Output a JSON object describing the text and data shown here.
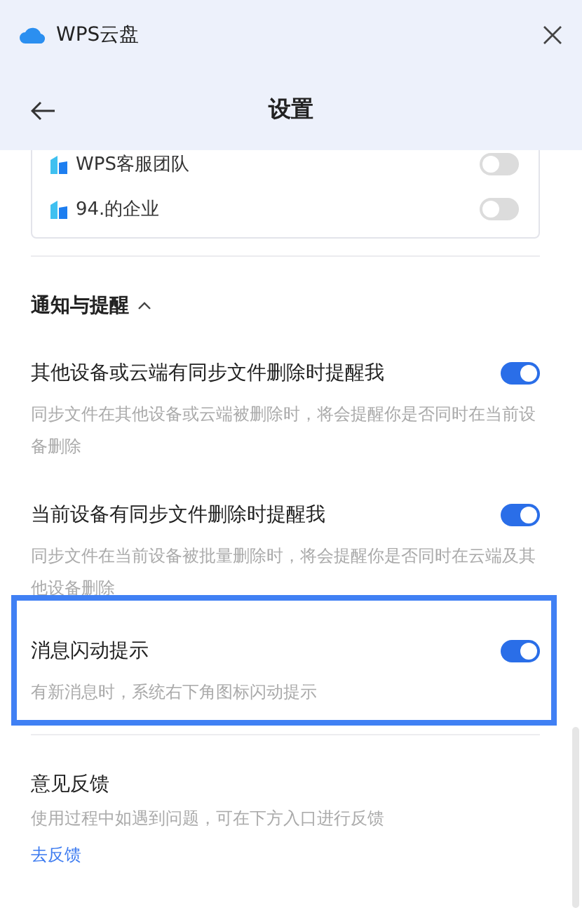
{
  "window": {
    "title": "WPS云盘"
  },
  "header": {
    "title": "设置"
  },
  "teams": [
    {
      "name": "WPS客服团队",
      "on": false
    },
    {
      "name": "94.的企业",
      "on": false
    }
  ],
  "section": {
    "title": "通知与提醒",
    "expanded": true
  },
  "settings": [
    {
      "title": "其他设备或云端有同步文件删除时提醒我",
      "description": "同步文件在其他设备或云端被删除时，将会提醒你是否同时在当前设备删除",
      "on": true,
      "highlighted": false
    },
    {
      "title": "当前设备有同步文件删除时提醒我",
      "description": "同步文件在当前设备被批量删除时，将会提醒你是否同时在云端及其他设备删除",
      "on": true,
      "highlighted": false
    },
    {
      "title": "消息闪动提示",
      "description": "有新消息时，系统右下角图标闪动提示",
      "on": true,
      "highlighted": true
    }
  ],
  "feedback": {
    "title": "意见反馈",
    "description": "使用过程中如遇到问题，可在下方入口进行反馈",
    "link": "去反馈"
  }
}
